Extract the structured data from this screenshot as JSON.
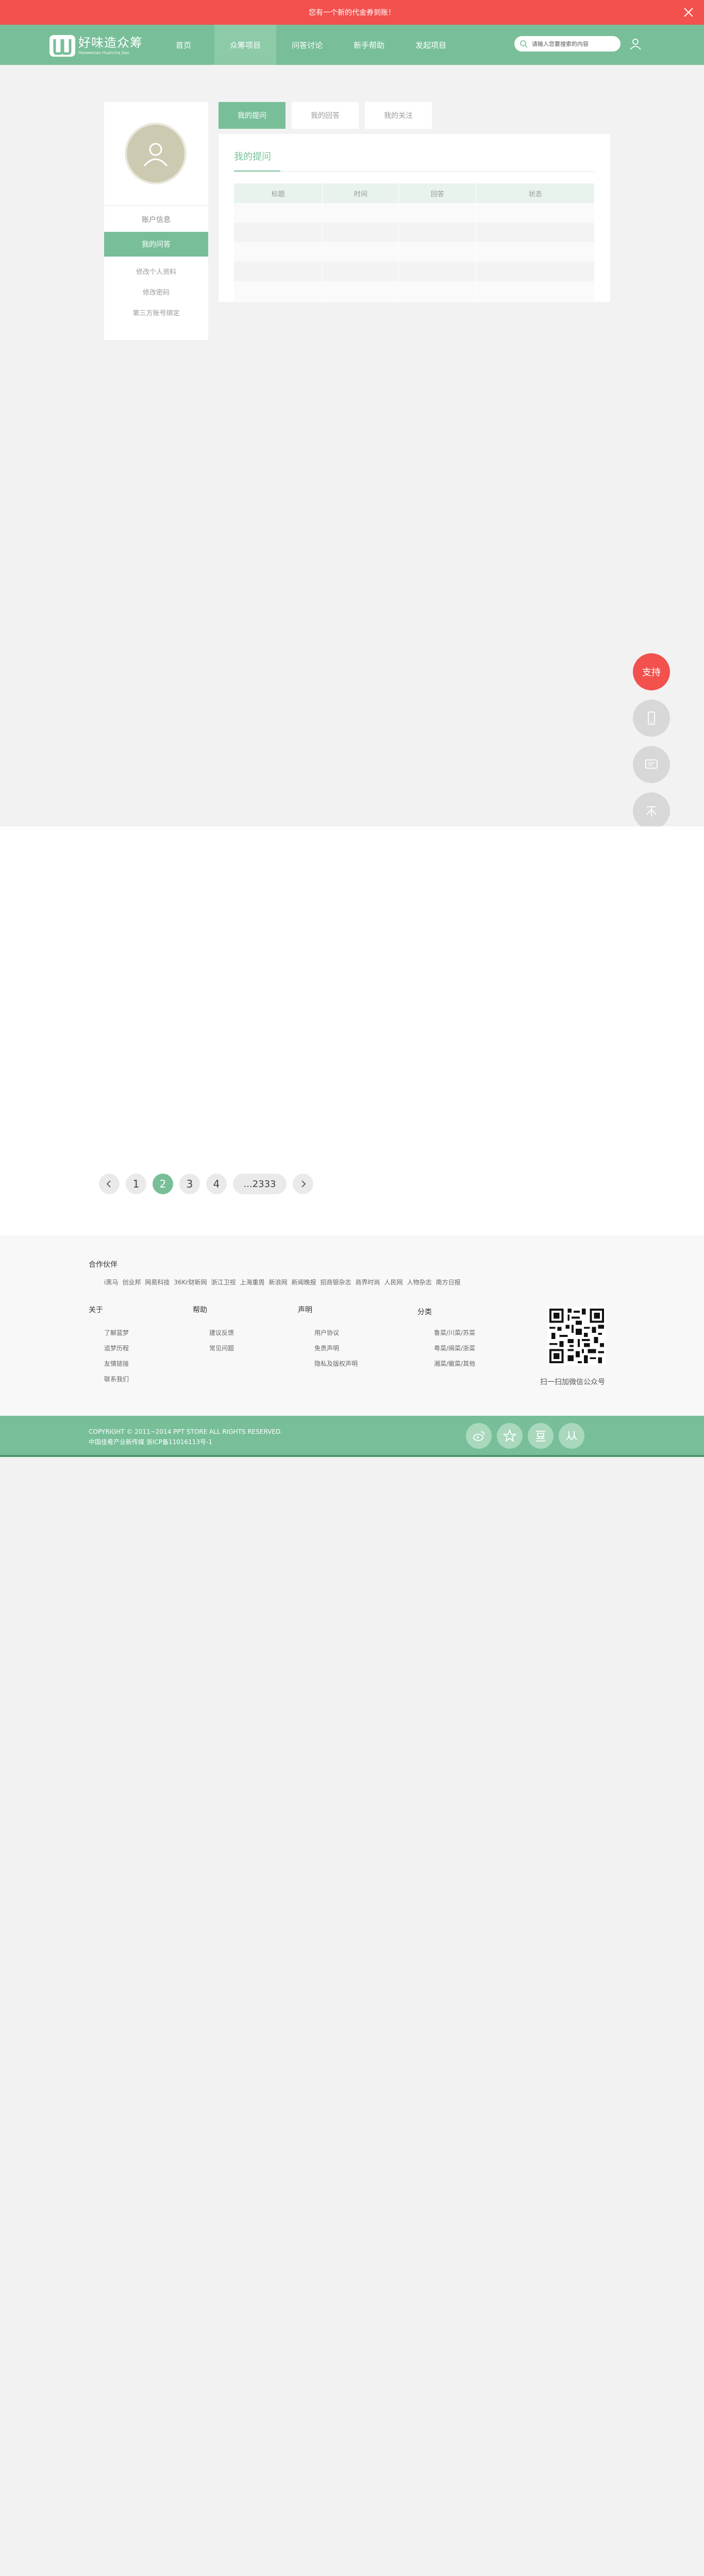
{
  "promo": {
    "text": "您有一个新的代金券到账！"
  },
  "brand": {
    "name": "好味造众筹",
    "subtitle": "Haoweizao Huancha Jiao"
  },
  "nav": {
    "items": [
      {
        "label": "首页"
      },
      {
        "label": "众筹项目"
      },
      {
        "label": "问答讨论"
      },
      {
        "label": "新手帮助"
      },
      {
        "label": "发起项目"
      }
    ],
    "active_index": 1
  },
  "search": {
    "placeholder": "请输入您要搜索的内容"
  },
  "sidebar": {
    "items": [
      {
        "label": "账户信息"
      },
      {
        "label": "我的问答"
      }
    ],
    "subitems": [
      {
        "label": "修改个人资料"
      },
      {
        "label": "修改密码"
      },
      {
        "label": "第三方账号绑定"
      }
    ]
  },
  "tabs": [
    {
      "label": "我的提问"
    },
    {
      "label": "我的回答"
    },
    {
      "label": "我的关注"
    }
  ],
  "panel": {
    "title": "我的提问",
    "columns": [
      "标题",
      "时间",
      "回答",
      "状态"
    ]
  },
  "float": {
    "primary_label": "支持"
  },
  "pagination": {
    "pages": [
      "1",
      "2",
      "3",
      "4",
      "...2333"
    ],
    "current": "2"
  },
  "footer": {
    "partners_title": "合作伙伴",
    "partners": [
      "i黑马",
      "创业邦",
      "网易科技",
      "36Kr财新网",
      "浙江卫视",
      "上海重周",
      "新浪网",
      "新闻晚报",
      "招商银杂志",
      "商界时尚",
      "人民网",
      "人物杂志",
      "南方日报"
    ],
    "columns": [
      {
        "title": "关于",
        "links": [
          "了解蓝梦",
          "追梦历程",
          "友情链接",
          "联系我们"
        ]
      },
      {
        "title": "帮助",
        "links": [
          "建议反馈",
          "常见问题"
        ]
      },
      {
        "title": "声明",
        "links": [
          "用户协议",
          "免责声明",
          "隐私及版权声明"
        ]
      },
      {
        "title": "分类",
        "links": [
          "鲁菜/川菜/苏菜",
          "粤菜/闽菜/浙菜",
          "湘菜/徽菜/其他"
        ]
      }
    ],
    "qr_caption": "扫一扫加微信公众号",
    "copyright": "COPYRIGHT © 2011~2014 PPT STORE ALL RIGHTS RESERVED.",
    "icp": "中国佳肴产业新传媒    浙ICP备11016113号-1"
  },
  "colors": {
    "brand_green": "#78bf99",
    "promo_red": "#f2514e"
  }
}
